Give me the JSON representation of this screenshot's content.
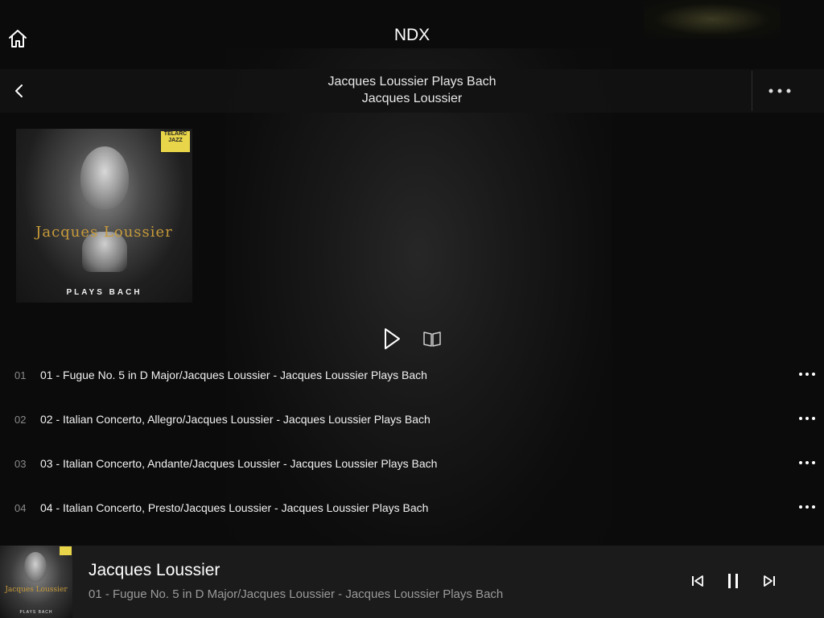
{
  "app": {
    "title": "NDX"
  },
  "album_header": {
    "title": "Jacques Loussier Plays Bach",
    "artist": "Jacques Loussier"
  },
  "cover": {
    "label_badge": "TELARC JAZZ",
    "artist_text": "Jacques Loussier",
    "subtitle": "PLAYS BACH"
  },
  "actions": {
    "play_icon": "play-icon",
    "booklet_icon": "book-icon"
  },
  "tracks": [
    {
      "num": "01",
      "name": "01 - Fugue No. 5 in D Major/Jacques Loussier - Jacques Loussier Plays Bach"
    },
    {
      "num": "02",
      "name": "02 - Italian Concerto, Allegro/Jacques Loussier - Jacques Loussier Plays Bach"
    },
    {
      "num": "03",
      "name": "03 - Italian Concerto, Andante/Jacques Loussier - Jacques Loussier Plays Bach"
    },
    {
      "num": "04",
      "name": "04 - Italian Concerto, Presto/Jacques Loussier - Jacques Loussier Plays Bach"
    }
  ],
  "now_playing": {
    "artist": "Jacques Loussier",
    "track": "01 - Fugue No. 5 in D Major/Jacques Loussier - Jacques Loussier Plays Bach",
    "thumb_artist": "Jacques Loussier",
    "thumb_subtitle": "PLAYS BACH"
  },
  "colors": {
    "background": "#0b0b0b",
    "header_bar": "#121212",
    "player_bar": "#1b1b1b",
    "cover_text_gold": "#c79a3a",
    "label_yellow": "#e9d54a"
  }
}
